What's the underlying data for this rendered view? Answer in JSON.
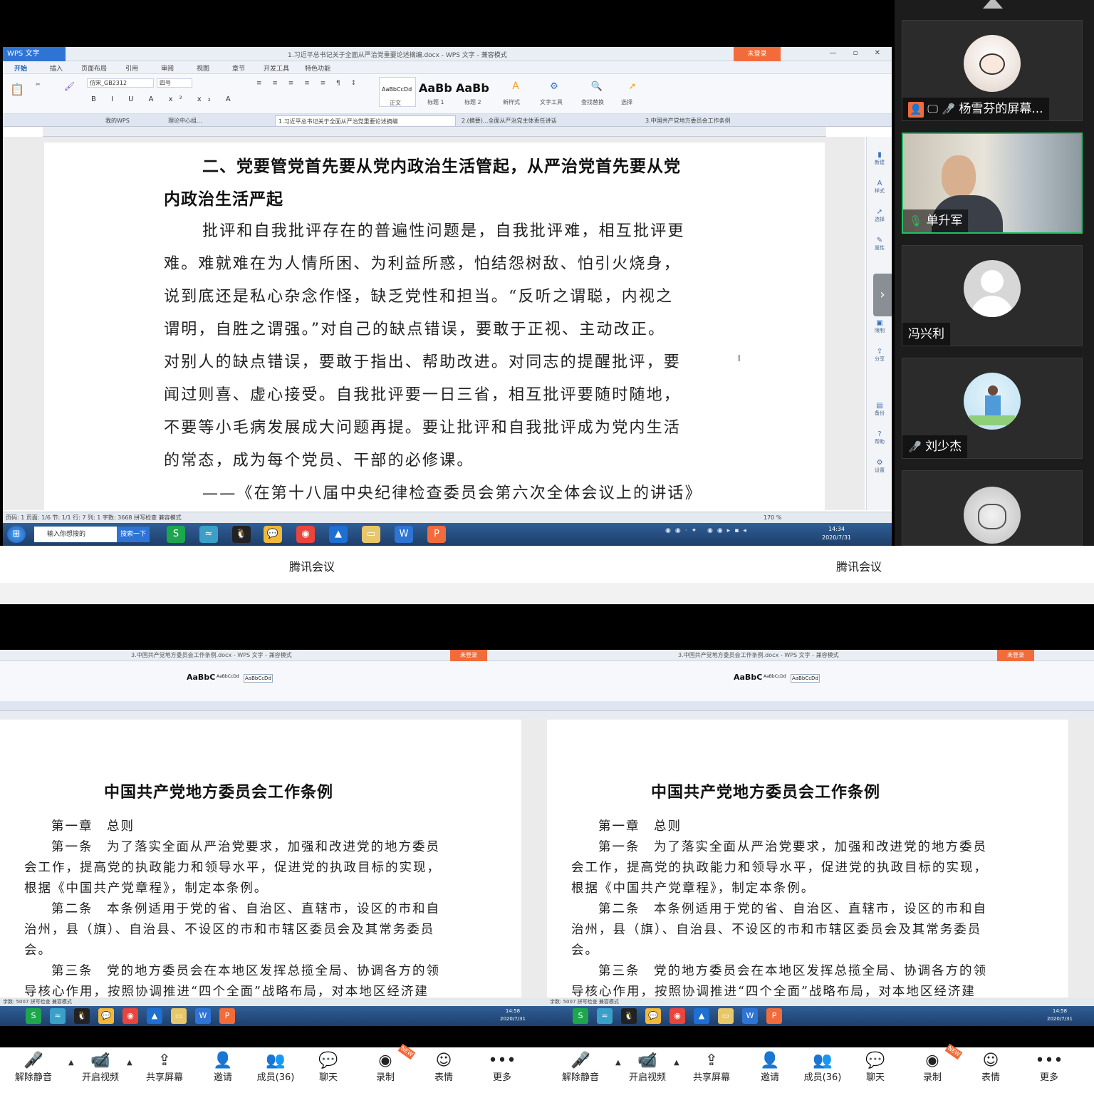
{
  "top_doc": {
    "app_title": "WPS 文字",
    "window_title": "1.习近平总书记关于全面从严治党重要论述摘编.docx - WPS 文字 - 兼容模式",
    "login_label": "未登录",
    "menu": [
      "开始",
      "插入",
      "页面布局",
      "引用",
      "审阅",
      "视图",
      "章节",
      "开发工具",
      "特色功能"
    ],
    "font_name": "仿宋_GB2312",
    "font_size": "四号",
    "styles": [
      "AaBbCcDd",
      "AaBb",
      "AaBb"
    ],
    "style_labels": [
      "正文",
      "标题 1",
      "标题 2"
    ],
    "ribbon_tools": [
      "新样式",
      "文字工具",
      "查找替换",
      "选择"
    ],
    "tabs": [
      "我的WPS",
      "理论中心组...",
      "1.习近平总书记关于全面从严治党重要论述摘编",
      "2.(摘要)...全面从严治党主体责任讲话",
      "3.中国共产党地方委员会工作条例"
    ],
    "heading_lines": [
      "二、党要管党首先要从党内政治生活管起，从严治党首先要从党",
      "内政治生活严起"
    ],
    "body_lines": [
      "批评和自我批评存在的普遍性问题是，自我批评难，相互批评更",
      "难。难就难在为人情所困、为利益所惑，怕结怨树敌、怕引火烧身，",
      "说到底还是私心杂念作怪，缺乏党性和担当。“反听之谓聪，内视之",
      "谓明，自胜之谓强。”对自己的缺点错误，要敢于正视、主动改正。",
      "对别人的缺点错误，要敢于指出、帮助改进。对同志的提醒批评，要",
      "闻过则喜、虚心接受。自我批评要一日三省，相互批评要随时随地，",
      "不要等小毛病发展成大问题再提。要让批评和自我批评成为党内生活",
      "的常态，成为每个党员、干部的必修课。",
      "——《在第十八届中央纪律检查委员会第六次全体会议上的讲话》"
    ],
    "side_panel": [
      "新建",
      "样式",
      "选择",
      "属性",
      "限制",
      "分享",
      "备份",
      "帮助",
      "设置"
    ],
    "status": "页码: 1  页面: 1/6  节: 1/1  行: 7  列: 1  字数: 3668  拼写检查  兼容模式",
    "zoom": "170 %",
    "taskbar_search": "输入你想搜的",
    "taskbar_search_btn": "搜索一下",
    "clock_time": "14:34",
    "clock_date": "2020/7/31"
  },
  "participants": [
    {
      "name": "杨雪芬的屏幕...",
      "mic": "muted",
      "sharing": true,
      "avatar": "cartoon-avatar"
    },
    {
      "name": "单升军",
      "mic": "on",
      "active": true,
      "avatar": "video-feed"
    },
    {
      "name": "冯兴利",
      "mic": "none",
      "avatar": "default-avatar"
    },
    {
      "name": "刘少杰",
      "mic": "muted",
      "avatar": "illustration-avatar"
    },
    {
      "name": "",
      "mic": "none",
      "avatar": "sketch-avatar"
    }
  ],
  "labels": [
    "腾讯会议",
    "腾讯会议"
  ],
  "bottom_doc": {
    "title": "中国共产党地方委员会工作条例",
    "window_title": "3.中国共产党地方委员会工作条例.docx - WPS 文字 - 兼容模式",
    "login_label": "未登录",
    "styles": [
      "AaBbC",
      "AaBbCcDd",
      "AaBbCcDd"
    ],
    "lines": [
      "第一章　总则",
      "第一条　为了落实全面从严治党要求，加强和改进党的地方委员",
      "会工作，提高党的执政能力和领导水平，促进党的执政目标的实现，",
      "根据《中国共产党章程》，制定本条例。",
      "第二条　本条例适用于党的省、自治区、直辖市，设区的市和自",
      "治州，县（旗）、自治县、不设区的市和市辖区委员会及其常务委员",
      "会。",
      "第三条　党的地方委员会在本地区发挥总揽全局、协调各方的领",
      "导核心作用，按照协调推进“四个全面”战略布局，对本地区经济建"
    ],
    "status": "字数: 5007  拼写检查  兼容模式",
    "clock_time": "14:58",
    "clock_date": "2020/7/31"
  },
  "toolbar": {
    "items": [
      "解除静音",
      "开启视频",
      "共享屏幕",
      "邀请",
      "成员(36)",
      "聊天",
      "录制",
      "表情",
      "更多"
    ],
    "new_badge": "NEW"
  },
  "colors": {
    "accent_green": "#20c160",
    "wps_blue": "#2e74d4",
    "login_orange": "#f26b3a"
  }
}
